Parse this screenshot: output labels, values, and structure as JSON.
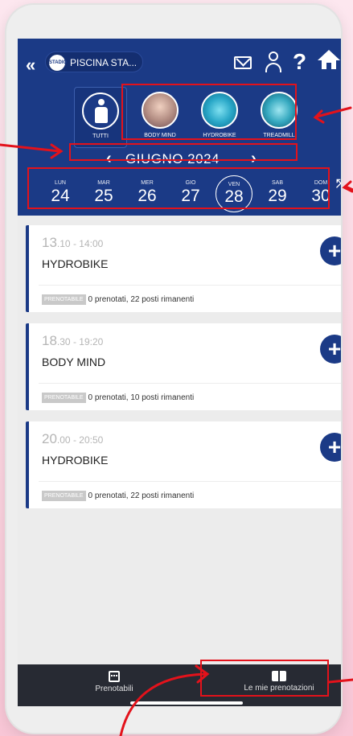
{
  "header": {
    "venue_logo_text": "STADIO",
    "venue_name": "PISCINA STA...",
    "icons": [
      "back-icon",
      "mail-icon",
      "user-icon",
      "help-icon",
      "home-icon"
    ]
  },
  "categories": [
    {
      "label": "TUTTI",
      "icon": "person-icon",
      "selected": true
    },
    {
      "label": "BODY MIND",
      "icon": "bodymind-image",
      "selected": false
    },
    {
      "label": "HYDROBIKE",
      "icon": "hydrobike-image",
      "selected": false
    },
    {
      "label": "TREADMILL",
      "icon": "treadmill-image",
      "selected": false
    }
  ],
  "month": {
    "label": "GIUGNO 2024",
    "prev": "‹",
    "next": "›"
  },
  "days": [
    {
      "name": "LUN",
      "num": "24"
    },
    {
      "name": "MAR",
      "num": "25"
    },
    {
      "name": "MER",
      "num": "26"
    },
    {
      "name": "GIO",
      "num": "27"
    },
    {
      "name": "VEN",
      "num": "28",
      "selected": true
    },
    {
      "name": "SAB",
      "num": "29"
    },
    {
      "name": "DOM",
      "num": "30"
    }
  ],
  "classes": [
    {
      "hour": "13",
      "time_rest": ".10 - 14:00",
      "title": "HYDROBIKE",
      "badge": "PRENOTABILE",
      "status": "0 prenotati, 22 posti rimanenti"
    },
    {
      "hour": "18",
      "time_rest": ".30 - 19:20",
      "title": "BODY MIND",
      "badge": "PRENOTABILE",
      "status": "0 prenotati, 10 posti rimanenti"
    },
    {
      "hour": "20",
      "time_rest": ".00 - 20:50",
      "title": "HYDROBIKE",
      "badge": "PRENOTABILE",
      "status": "0 prenotati, 22 posti rimanenti"
    }
  ],
  "bottom_nav": [
    {
      "label": "Prenotabili",
      "icon": "calendar-icon"
    },
    {
      "label": "Le mie prenotazioni",
      "icon": "book-icon"
    }
  ],
  "colors": {
    "primary": "#1b3a86",
    "annotation": "#e3121b",
    "bottom_bar": "#272a33"
  }
}
